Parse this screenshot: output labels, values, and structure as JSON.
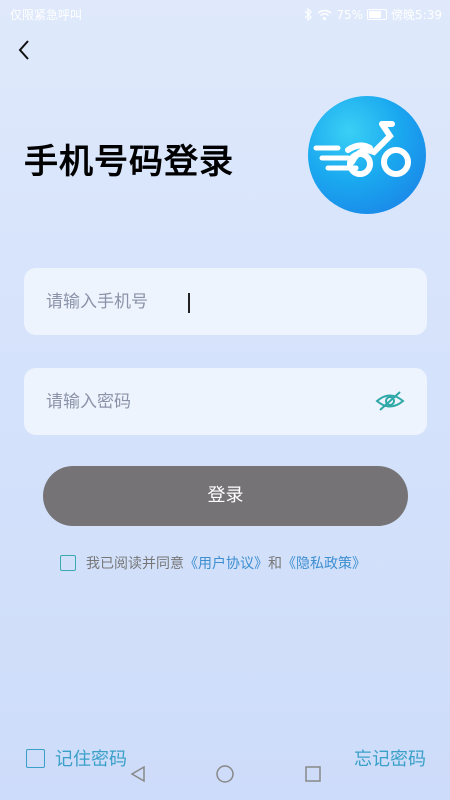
{
  "status_bar": {
    "carrier": "仅限紧急呼叫",
    "battery": "75%",
    "time": "傍晚5:39"
  },
  "header": {
    "title": "手机号码登录"
  },
  "form": {
    "phone_placeholder": "请输入手机号",
    "password_placeholder": "请输入密码",
    "login_label": "登录"
  },
  "agreement": {
    "prefix": "我已阅读并同意",
    "user_agreement": "《用户协议》",
    "and": "和",
    "privacy_policy": "《隐私政策》"
  },
  "footer": {
    "remember_password": "记住密码",
    "forgot_password": "忘记密码"
  },
  "colors": {
    "accent": "#3aa0c8",
    "login_button": "#767377",
    "logo_blue": "#1aa8ef",
    "link": "#3d8fd1"
  },
  "icons": [
    "back-arrow-icon",
    "wifi-icon",
    "bluetooth-icon",
    "battery-icon",
    "eye-icon",
    "scooter-logo-icon",
    "nav-back-icon",
    "nav-home-icon",
    "nav-recent-icon"
  ]
}
